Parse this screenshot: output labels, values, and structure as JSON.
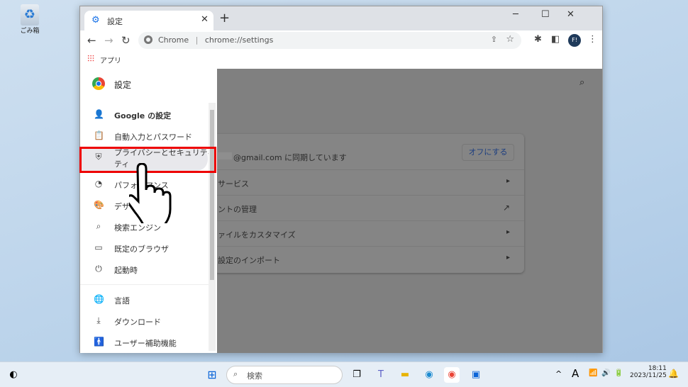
{
  "desktop": {
    "recycle_bin_label": "ごみ箱"
  },
  "browser": {
    "tab_title": "設定",
    "omnibox": {
      "site": "Chrome",
      "url": "chrome://settings"
    },
    "bookmarks": [
      {
        "label": "アプリ"
      }
    ]
  },
  "settings": {
    "title": "設定",
    "sidebar_items": [
      {
        "label": "Google の設定",
        "icon": "person-icon"
      },
      {
        "label": "自動入力とパスワード",
        "icon": "clipboard-icon"
      },
      {
        "label": "プライバシーとセキュリティ",
        "label2": "ティ",
        "icon": "shield-icon",
        "selected": true
      },
      {
        "label": "パフォーマンス",
        "icon": "speedometer-icon"
      },
      {
        "label": "デザイン",
        "icon": "palette-icon"
      },
      {
        "label": "検索エンジン",
        "icon": "search-icon"
      },
      {
        "label": "既定のブラウザ",
        "icon": "browser-icon"
      },
      {
        "label": "起動時",
        "icon": "power-icon"
      },
      {
        "label": "言語",
        "icon": "globe-icon"
      },
      {
        "label": "ダウンロード",
        "icon": "download-icon"
      },
      {
        "label": "ユーザー補助機能",
        "icon": "accessibility-icon"
      }
    ],
    "sync_text": "@gmail.com に同期しています",
    "turn_off_label": "オフにする",
    "rows": [
      {
        "label": "サービス"
      },
      {
        "label": "ントの管理"
      },
      {
        "label": "ァイルをカスタマイズ"
      },
      {
        "label": "設定のインポート"
      }
    ]
  },
  "taskbar": {
    "search_placeholder": "検索",
    "ime": "A",
    "time": "18:11",
    "date": "2023/11/25"
  },
  "colors": {
    "highlight": "#e00000",
    "accent": "#1a73e8"
  }
}
